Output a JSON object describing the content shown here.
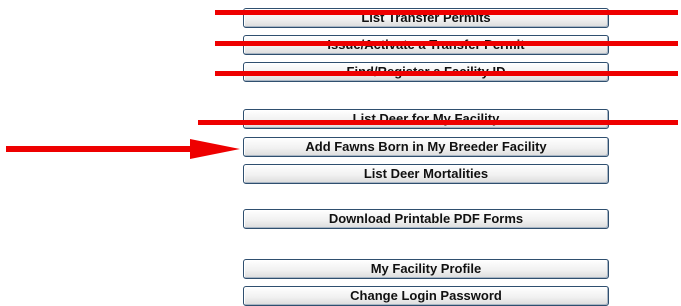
{
  "menu": {
    "list_transfer_permits": "List Transfer Permits",
    "issue_activate_transfer_permit": "Issue/Activate a Transfer Permit",
    "find_register_facility_id": "Find/Register a Facility ID",
    "list_deer_for_my_facility": "List Deer for My Facility",
    "add_fawns_born": "Add Fawns Born in My Breeder Facility",
    "list_deer_mortalities": "List Deer Mortalities",
    "download_printable_pdf_forms": "Download Printable PDF Forms",
    "my_facility_profile": "My Facility Profile",
    "change_login_password": "Change Login Password"
  },
  "annotations": {
    "color": "#ee0000",
    "strikethrough_count": 4,
    "arrow_target": "Add Fawns Born in My Breeder Facility"
  }
}
